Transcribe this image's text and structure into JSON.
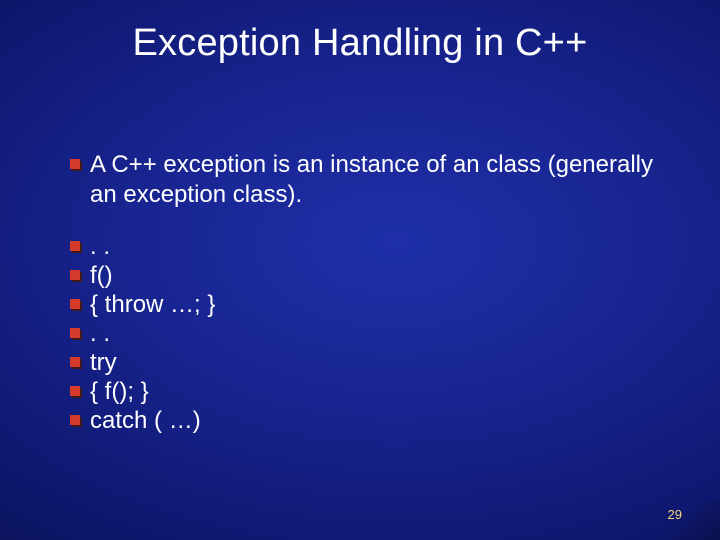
{
  "title": "Exception Handling in C++",
  "bullets": {
    "intro": "A C++ exception is an instance of an class (generally an exception class).",
    "code": [
      ". .",
      " f()",
      " { throw …; }",
      ". .",
      " try",
      " {  f(); }",
      " catch ( …)"
    ]
  },
  "page_number": "29"
}
